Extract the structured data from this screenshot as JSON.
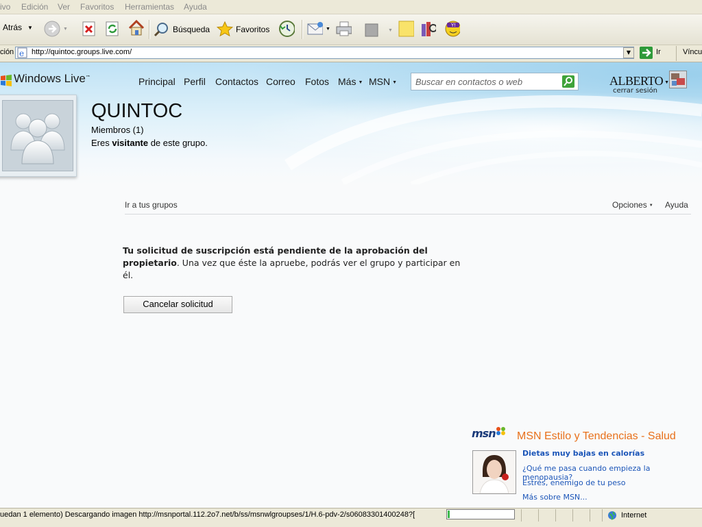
{
  "browser": {
    "menu": [
      "ivo",
      "Edición",
      "Ver",
      "Favoritos",
      "Herramientas",
      "Ayuda"
    ],
    "toolbar": {
      "back_label": "Atrás",
      "search_label": "Búsqueda",
      "favorites_label": "Favoritos"
    },
    "address": {
      "label": "ción",
      "url": "http://quintoc.groups.live.com/",
      "go_label": "Ir",
      "links_label": "Víncul"
    }
  },
  "header": {
    "logo_text": "Windows Live",
    "logo_tm": "™",
    "nav": [
      "Principal",
      "Perfil",
      "Contactos",
      "Correo",
      "Fotos",
      "Más",
      "MSN"
    ],
    "search_placeholder": "Buscar en contactos o web",
    "user_name": "ALBERTO",
    "sign_out": "cerrar sesión"
  },
  "group": {
    "name": "QUINTOC",
    "members": "Miembros (1)",
    "role_prefix": "Eres ",
    "role": "visitante",
    "role_suffix": " de este grupo."
  },
  "subnav": {
    "my_groups": "Ir a tus grupos",
    "options": "Opciones",
    "help": "Ayuda"
  },
  "message": {
    "bold": "Tu solicitud de suscripción está pendiente de la aprobación del propietario",
    "rest": ". Una vez que éste la apruebe, podrás ver el grupo y participar en él.",
    "cancel_button": "Cancelar solicitud"
  },
  "promo": {
    "brand": "msn",
    "title": "MSN Estilo y Tendencias - Salud",
    "headline": "Dietas muy bajas en calorías",
    "links": [
      "¿Qué me pasa cuando empieza la menopausia?",
      "Estrés, enemigo de tu peso",
      "Más sobre MSN..."
    ]
  },
  "status": {
    "text": "uedan 1 elemento) Descargando imagen http://msnportal.112.2o7.net/b/ss/msnwlgroupses/1/H.6-pdv-2/s06083301400248?[",
    "progress": 0.03,
    "zone": "Internet"
  },
  "colors": {
    "msn_orange": "#e8701a",
    "link_blue": "#1b55b8",
    "progress_green": "#3bb84a"
  }
}
